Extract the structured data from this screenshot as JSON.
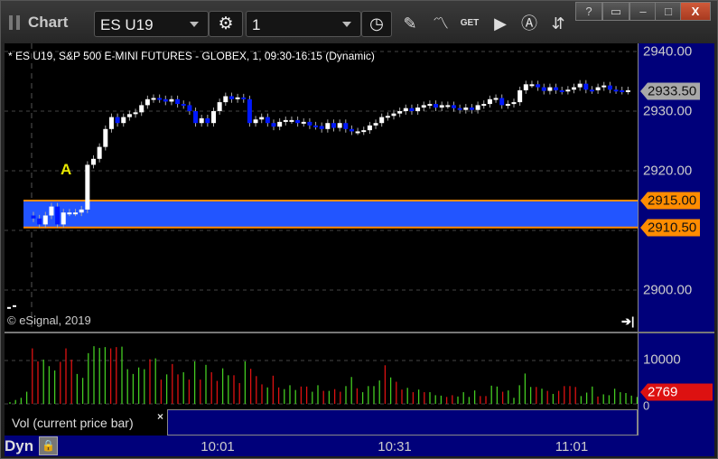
{
  "window": {
    "title": "Chart",
    "buttons": [
      "?",
      "restore-down",
      "minimize",
      "maximize",
      "X"
    ]
  },
  "toolbar": {
    "symbol": "ES U19",
    "interval": "1",
    "tools": [
      "pencil-icon",
      "study-icon",
      "get-icon",
      "play-icon",
      "alert-icon",
      "link-icon"
    ]
  },
  "chart": {
    "info": "* ES U19, S&P 500 E-MINI FUTURES - GLOBEX, 1, 09:30-16:15 (Dynamic)",
    "copyright": "© eSignal, 2019",
    "marker": "A",
    "price_labels": [
      "2940.00",
      "2930.00",
      "2920.00",
      "2900.00"
    ],
    "current_price": "2933.50",
    "band_high": "2915.00",
    "band_low": "2910.50",
    "colors": {
      "up": "#ffffff",
      "down": "#0018ff",
      "band": "#2255ff",
      "band_line": "#ff8c00",
      "axis": "#00007a",
      "vol_up": "#44cc22",
      "vol_down": "#dd1111"
    }
  },
  "chart_data": {
    "type": "candlestick",
    "ylim": [
      2896,
      2941.5
    ],
    "pre_session_closes": [
      2897,
      2897.3
    ],
    "closes": [
      2912,
      2911,
      2912.5,
      2914,
      2911,
      2913,
      2913,
      2913,
      2913.5,
      2921,
      2922,
      2924,
      2927,
      2929,
      2928,
      2929,
      2929.5,
      2929.8,
      2931,
      2932,
      2932.2,
      2932,
      2931.6,
      2932,
      2931.2,
      2931,
      2930,
      2928,
      2928.8,
      2928,
      2930,
      2931.5,
      2932.5,
      2932,
      2932.3,
      2932,
      2928,
      2928.6,
      2929,
      2928,
      2927.4,
      2928.2,
      2928.5,
      2928.5,
      2928,
      2928.2,
      2927.6,
      2927.5,
      2927,
      2928,
      2927.2,
      2928,
      2927,
      2926.6,
      2926.6,
      2926.8,
      2927.6,
      2928,
      2929,
      2929.2,
      2929.6,
      2930,
      2930.5,
      2930,
      2930.6,
      2931,
      2931.2,
      2930.6,
      2931,
      2931,
      2930.5,
      2930.2,
      2930.6,
      2930.2,
      2931,
      2931.2,
      2932,
      2932.2,
      2931,
      2931.2,
      2931.5,
      2933.5,
      2934.5,
      2934.5,
      2934,
      2933.4,
      2934,
      2933.5,
      2933.4,
      2933.6,
      2934,
      2934.6,
      2933.6,
      2933.5,
      2934,
      2934.3,
      2933.6,
      2933.5,
      2933.4,
      2933.5
    ],
    "volume_ylim": [
      0,
      13500
    ],
    "volume_ticks": [
      "10000",
      "0"
    ],
    "current_volume": "2769",
    "volumes": [
      400,
      900,
      1400,
      2800,
      12800,
      9800,
      10200,
      8700,
      7700,
      9700,
      12800,
      10200,
      6900,
      6000,
      11700,
      13300,
      12900,
      13100,
      12800,
      13100,
      13200,
      8000,
      6900,
      8400,
      8000,
      10300,
      10500,
      5600,
      6800,
      9200,
      6800,
      7300,
      5600,
      9800,
      5600,
      9000,
      7300,
      5300,
      8200,
      6600,
      6600,
      4800,
      9800,
      8100,
      6400,
      4500,
      3800,
      6500,
      3800,
      3400,
      4300,
      3200,
      4000,
      4000,
      2800,
      4300,
      3000,
      3000,
      3400,
      2800,
      4100,
      6200,
      3600,
      2700,
      4100,
      4100,
      5400,
      8900,
      6100,
      5100,
      3300,
      3700,
      2700,
      3300,
      2700,
      2700,
      2000,
      1900,
      1600,
      2000,
      1700,
      2700,
      1600,
      3100,
      1800,
      1800,
      4200,
      4000,
      2800,
      3100,
      1400,
      4300,
      7000,
      3900,
      3900,
      3500,
      3000,
      2300,
      3000,
      4100,
      4100,
      3900,
      1800,
      2600,
      4000,
      1700,
      2200,
      2000,
      3500,
      2700,
      2500,
      1900,
      1600
    ],
    "volume_dirs": "ggggrrgggrrrggggggrrgggggrgrgrrgrgrgrrggrrgrrrgrrgggrrggrgrrggrggggrgrrgrgrgggrrggggrrggrgggggrgrgrrrrgggr",
    "x_tick_labels": [
      "10:01",
      "10:31",
      "11:01"
    ]
  },
  "volume_pane": {
    "legend": "Vol (current price bar)",
    "close": "×"
  },
  "footer": {
    "mode": "Dyn"
  }
}
